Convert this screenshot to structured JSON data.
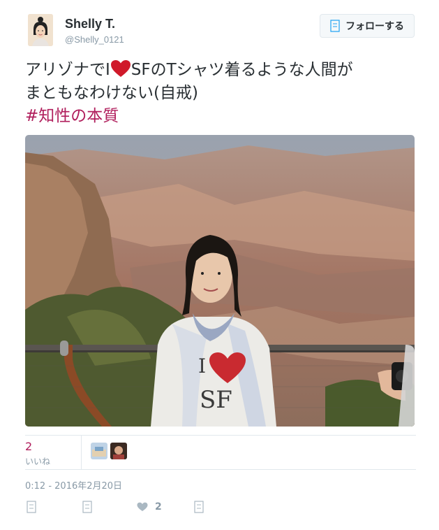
{
  "user": {
    "display_name": "Shelly T.",
    "handle": "@Shelly_0121"
  },
  "follow_button": {
    "label": "フォローする",
    "icon": "follow-icon"
  },
  "tweet": {
    "text_before_heart": "アリゾナでI",
    "text_after_heart": "SFのTシャツ着るような人間が",
    "text_line2": "まともなわけない(自戒)",
    "hashtag": "#知性の本質",
    "heart_color": "#d0192a"
  },
  "stats": {
    "likes_count": "2",
    "likes_label": "いいね"
  },
  "timestamp": "0:12 - 2016年2月20日",
  "actions": {
    "like_count": "2"
  },
  "colors": {
    "hashtag": "#b01e5c",
    "muted": "#8899a6",
    "text": "#292f33"
  }
}
